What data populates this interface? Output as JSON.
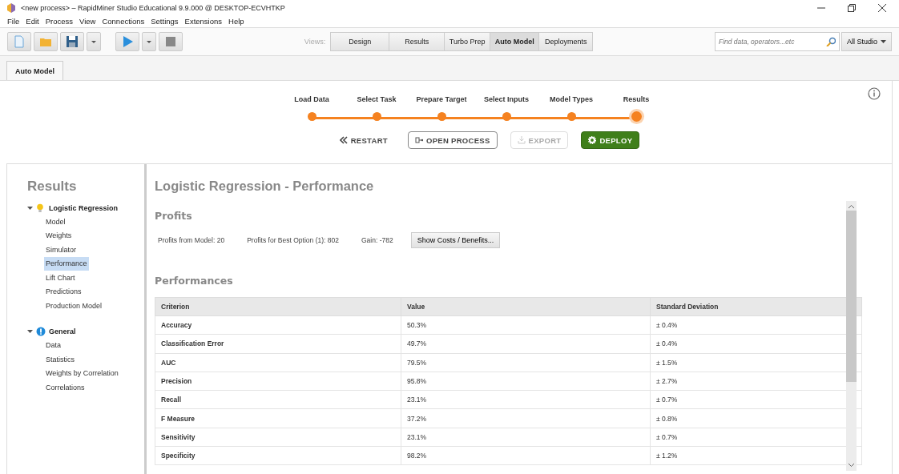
{
  "window": {
    "title": "<new process> – RapidMiner Studio Educational 9.9.000 @ DESKTOP-ECVHTKP"
  },
  "menu": [
    "File",
    "Edit",
    "Process",
    "View",
    "Connections",
    "Settings",
    "Extensions",
    "Help"
  ],
  "toolbar": {
    "views_label": "Views:",
    "views": [
      {
        "label": "Design",
        "selected": false
      },
      {
        "label": "Results",
        "selected": false
      },
      {
        "label": "Turbo Prep",
        "selected": false
      },
      {
        "label": "Auto Model",
        "selected": true
      },
      {
        "label": "Deployments",
        "selected": false
      }
    ],
    "search": {
      "placeholder": "Find data, operators...etc"
    },
    "scope": "All Studio"
  },
  "tabs": [
    {
      "label": "Auto Model",
      "selected": true
    }
  ],
  "wizard": {
    "steps": [
      {
        "label": "Load Data",
        "selected": false
      },
      {
        "label": "Select Task",
        "selected": false
      },
      {
        "label": "Prepare Target",
        "selected": false
      },
      {
        "label": "Select Inputs",
        "selected": false
      },
      {
        "label": "Model Types",
        "selected": false
      },
      {
        "label": "Results",
        "selected": true
      }
    ],
    "actions": [
      {
        "kind": "restart",
        "label": "RESTART",
        "disabled": false
      },
      {
        "kind": "open",
        "label": "OPEN PROCESS",
        "disabled": false
      },
      {
        "kind": "export",
        "label": "EXPORT",
        "disabled": true
      },
      {
        "kind": "deploy",
        "label": "DEPLOY",
        "disabled": false
      }
    ]
  },
  "sidebar": {
    "title": "Results",
    "groups": [
      {
        "label": "Logistic Regression",
        "expanded": true,
        "children": [
          {
            "label": "Model",
            "selected": false
          },
          {
            "label": "Weights",
            "selected": false
          },
          {
            "label": "Simulator",
            "selected": false
          },
          {
            "label": "Performance",
            "selected": true
          },
          {
            "label": "Lift Chart",
            "selected": false
          },
          {
            "label": "Predictions",
            "selected": false
          },
          {
            "label": "Production Model",
            "selected": false
          }
        ]
      },
      {
        "label": "General",
        "expanded": true,
        "children": [
          {
            "label": "Data",
            "selected": false
          },
          {
            "label": "Statistics",
            "selected": false
          },
          {
            "label": "Weights by Correlation",
            "selected": false
          },
          {
            "label": "Correlations",
            "selected": false
          }
        ]
      }
    ]
  },
  "content": {
    "title": "Logistic Regression - Performance",
    "profits": {
      "heading": "Profits",
      "items": [
        "Profits from Model: 20",
        "Profits for Best Option (1): 802",
        "Gain: -782"
      ],
      "button": "Show Costs / Benefits..."
    },
    "performances": {
      "heading": "Performances",
      "columns": [
        "Criterion",
        "Value",
        "Standard Deviation"
      ],
      "rows": [
        [
          "Accuracy",
          "50.3%",
          "± 0.4%"
        ],
        [
          "Classification Error",
          "49.7%",
          "± 0.4%"
        ],
        [
          "AUC",
          "79.5%",
          "± 1.5%"
        ],
        [
          "Precision",
          "95.8%",
          "± 2.7%"
        ],
        [
          "Recall",
          "23.1%",
          "± 0.7%"
        ],
        [
          "F Measure",
          "37.2%",
          "± 0.8%"
        ],
        [
          "Sensitivity",
          "23.1%",
          "± 0.7%"
        ],
        [
          "Specificity",
          "98.2%",
          "± 1.2%"
        ]
      ]
    }
  }
}
